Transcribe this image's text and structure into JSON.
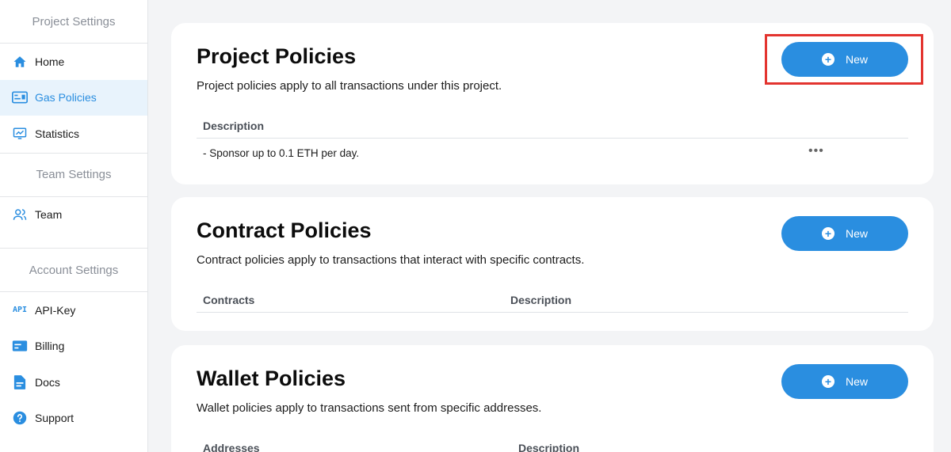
{
  "sidebar": {
    "project_title": "Project Settings",
    "team_title": "Team Settings",
    "account_title": "Account Settings",
    "items": {
      "home": "Home",
      "gas_policies": "Gas Policies",
      "statistics": "Statistics",
      "team": "Team",
      "api_key": "API-Key",
      "billing": "Billing",
      "docs": "Docs",
      "support": "Support"
    },
    "api_icon_text": "API"
  },
  "project_policies": {
    "title": "Project Policies",
    "description": "Project policies apply to all transactions under this project.",
    "new_label": "New",
    "column_description": "Description",
    "rows": [
      "- Sponsor up to 0.1 ETH per day."
    ],
    "row_menu": "•••"
  },
  "contract_policies": {
    "title": "Contract Policies",
    "description": "Contract policies apply to transactions that interact with specific contracts.",
    "new_label": "New",
    "column_contracts": "Contracts",
    "column_description": "Description"
  },
  "wallet_policies": {
    "title": "Wallet Policies",
    "description": "Wallet policies apply to transactions sent from specific addresses.",
    "new_label": "New",
    "column_addresses": "Addresses",
    "column_description": "Description"
  },
  "colors": {
    "accent": "#2a8ee0",
    "highlight": "#e3342f",
    "active_bg": "#e8f3fc"
  }
}
